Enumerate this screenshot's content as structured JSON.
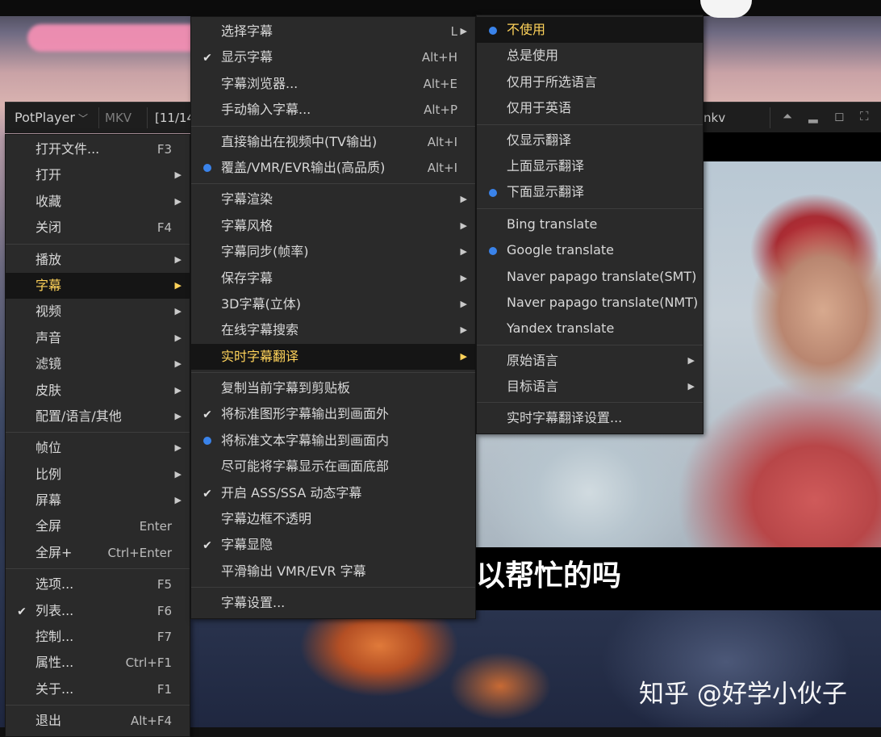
{
  "titlebar": {
    "brand": "PotPlayer",
    "format": "MKV",
    "index": "[11/14",
    "file": "nkv"
  },
  "main_menu": [
    {
      "label": "打开文件...",
      "shortcut": "F3"
    },
    {
      "label": "打开",
      "submenu": true
    },
    {
      "label": "收藏",
      "submenu": true
    },
    {
      "label": "关闭",
      "shortcut": "F4"
    },
    {
      "sep": true
    },
    {
      "label": "播放",
      "submenu": true
    },
    {
      "label": "字幕",
      "submenu": true,
      "highlight": true
    },
    {
      "label": "视频",
      "submenu": true
    },
    {
      "label": "声音",
      "submenu": true
    },
    {
      "label": "滤镜",
      "submenu": true
    },
    {
      "label": "皮肤",
      "submenu": true
    },
    {
      "label": "配置/语言/其他",
      "submenu": true
    },
    {
      "sep": true
    },
    {
      "label": "帧位",
      "submenu": true
    },
    {
      "label": "比例",
      "submenu": true
    },
    {
      "label": "屏幕",
      "submenu": true
    },
    {
      "label": "全屏",
      "shortcut": "Enter"
    },
    {
      "label": "全屏+",
      "shortcut": "Ctrl+Enter"
    },
    {
      "sep": true
    },
    {
      "label": "选项...",
      "shortcut": "F5"
    },
    {
      "label": "列表...",
      "shortcut": "F6",
      "mark": "check"
    },
    {
      "label": "控制...",
      "shortcut": "F7"
    },
    {
      "label": "属性...",
      "shortcut": "Ctrl+F1"
    },
    {
      "label": "关于...",
      "shortcut": "F1"
    },
    {
      "sep": true
    },
    {
      "label": "退出",
      "shortcut": "Alt+F4"
    }
  ],
  "subtitle_menu": [
    {
      "label": "选择字幕",
      "shortcut": "L",
      "submenu": true
    },
    {
      "label": "显示字幕",
      "shortcut": "Alt+H",
      "mark": "check"
    },
    {
      "label": "字幕浏览器...",
      "shortcut": "Alt+E"
    },
    {
      "label": "手动输入字幕...",
      "shortcut": "Alt+P"
    },
    {
      "sep": true
    },
    {
      "label": "直接输出在视频中(TV输出)",
      "shortcut": "Alt+I"
    },
    {
      "label": "覆盖/VMR/EVR输出(高品质)",
      "shortcut": "Alt+I",
      "mark": "dot"
    },
    {
      "sep": true
    },
    {
      "label": "字幕渲染",
      "submenu": true
    },
    {
      "label": "字幕风格",
      "submenu": true
    },
    {
      "label": "字幕同步(帧率)",
      "submenu": true
    },
    {
      "label": "保存字幕",
      "submenu": true
    },
    {
      "label": "3D字幕(立体)",
      "submenu": true
    },
    {
      "label": "在线字幕搜索",
      "submenu": true
    },
    {
      "label": "实时字幕翻译",
      "submenu": true,
      "highlight": true
    },
    {
      "sep": true
    },
    {
      "label": "复制当前字幕到剪贴板"
    },
    {
      "label": "将标准图形字幕输出到画面外",
      "mark": "check"
    },
    {
      "label": "将标准文本字幕输出到画面内",
      "mark": "dot"
    },
    {
      "label": "尽可能将字幕显示在画面底部"
    },
    {
      "label": "开启 ASS/SSA 动态字幕",
      "mark": "check"
    },
    {
      "label": "字幕边框不透明"
    },
    {
      "label": "字幕显隐",
      "mark": "check"
    },
    {
      "label": "平滑输出 VMR/EVR 字幕"
    },
    {
      "sep": true
    },
    {
      "label": "字幕设置..."
    }
  ],
  "translate_menu": [
    {
      "label": "不使用",
      "mark": "dot",
      "highlight": true
    },
    {
      "label": "总是使用"
    },
    {
      "label": "仅用于所选语言"
    },
    {
      "label": "仅用于英语"
    },
    {
      "sep": true
    },
    {
      "label": "仅显示翻译"
    },
    {
      "label": "上面显示翻译"
    },
    {
      "label": "下面显示翻译",
      "mark": "dot"
    },
    {
      "sep": true
    },
    {
      "label": "Bing translate"
    },
    {
      "label": "Google translate",
      "mark": "dot"
    },
    {
      "label": "Naver papago translate(SMT)"
    },
    {
      "label": "Naver papago translate(NMT)"
    },
    {
      "label": "Yandex translate"
    },
    {
      "sep": true
    },
    {
      "label": "原始语言",
      "submenu": true
    },
    {
      "label": "目标语言",
      "submenu": true
    },
    {
      "sep": true
    },
    {
      "label": "实时字幕翻译设置..."
    }
  ],
  "video": {
    "subtitle_text": "以帮忙的吗"
  },
  "watermark": "知乎 @好学小伙子",
  "colors": {
    "menu_bg": "#2a2a2a",
    "highlight_text": "#ffd35a",
    "radio_dot": "#3a83ea"
  }
}
